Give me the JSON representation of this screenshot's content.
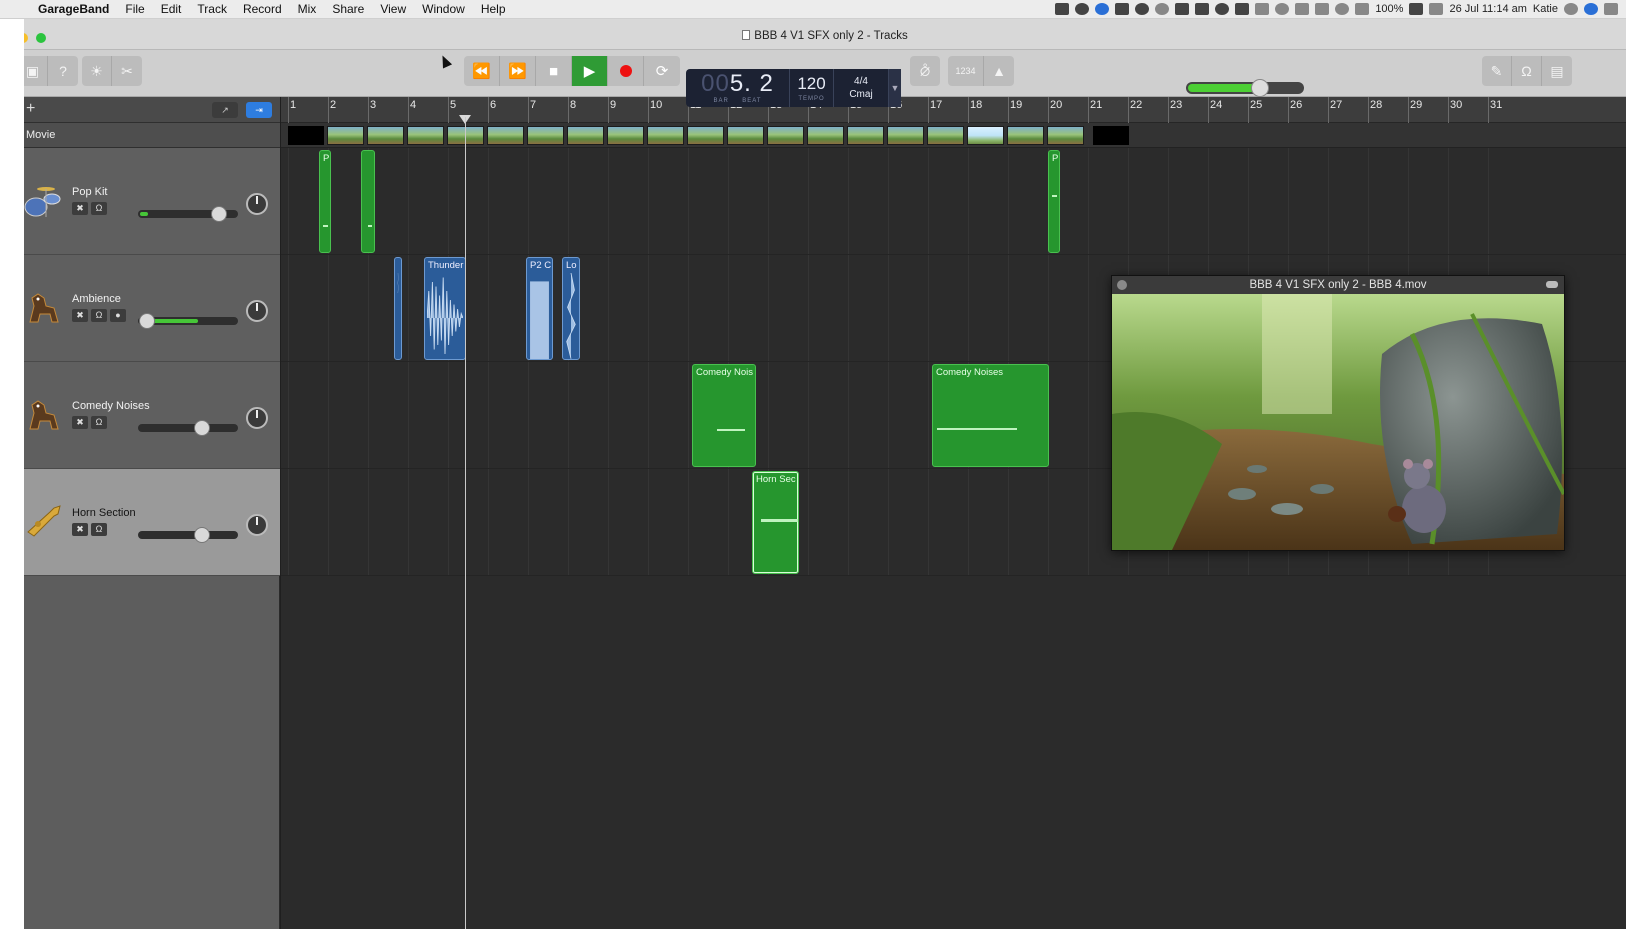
{
  "menubar": {
    "app": "GarageBand",
    "items": [
      "File",
      "Edit",
      "Track",
      "Record",
      "Mix",
      "Share",
      "View",
      "Window",
      "Help"
    ],
    "battery": "100%",
    "datetime": "26 Jul 11:14 am",
    "user": "Katie"
  },
  "window": {
    "title": "BBB 4 V1 SFX only 2 - Tracks"
  },
  "toolbar": {
    "lcd": {
      "bar_dim": "00",
      "position": "5. 2",
      "bar_label": "BAR",
      "beat_label": "BEAT",
      "tempo": "120",
      "tempo_label": "TEMPO",
      "time_signature": "4/4",
      "key": "Cmaj"
    },
    "count_in_label": "1234",
    "master_volume_fraction": 0.62
  },
  "ruler": {
    "bars": [
      "1",
      "2",
      "3",
      "4",
      "5",
      "6",
      "7",
      "8",
      "9",
      "10",
      "11",
      "12",
      "13",
      "14",
      "15",
      "16",
      "17",
      "18",
      "19",
      "20",
      "21",
      "22",
      "23",
      "24",
      "25",
      "26",
      "27",
      "28",
      "29",
      "30",
      "31"
    ]
  },
  "movie_track": {
    "label": "Movie"
  },
  "tracks": [
    {
      "name": "Pop Kit",
      "icon": "drum-kit-icon",
      "volume_fraction": 0.89,
      "meter_fraction": 0.08,
      "selected": false
    },
    {
      "name": "Ambience",
      "icon": "dog-icon",
      "volume_fraction": 0.03,
      "meter_fraction": 0.6,
      "selected": false
    },
    {
      "name": "Comedy Noises",
      "icon": "dog-icon",
      "volume_fraction": 0.69,
      "meter_fraction": 0,
      "selected": false
    },
    {
      "name": "Horn Section",
      "icon": "trumpet-icon",
      "volume_fraction": 0.69,
      "meter_fraction": 0,
      "selected": true
    }
  ],
  "regions": {
    "pop_kit": [
      {
        "label": "P"
      },
      {
        "label": ""
      },
      {
        "label": "P"
      }
    ],
    "ambience": [
      {
        "label": ""
      },
      {
        "label": "Thunder"
      },
      {
        "label": "P2 C"
      },
      {
        "label": "Lo"
      }
    ],
    "comedy": [
      {
        "label": "Comedy Nois"
      },
      {
        "label": "Comedy Noises"
      }
    ],
    "horn": [
      {
        "label": "Horn Sec"
      }
    ]
  },
  "movie_window": {
    "title": "BBB 4 V1 SFX only 2 - BBB 4.mov"
  },
  "colors": {
    "region_green": "#26962e",
    "region_blue": "#2b5c99",
    "play_green": "#2f9b35",
    "record_red": "#e11111"
  }
}
